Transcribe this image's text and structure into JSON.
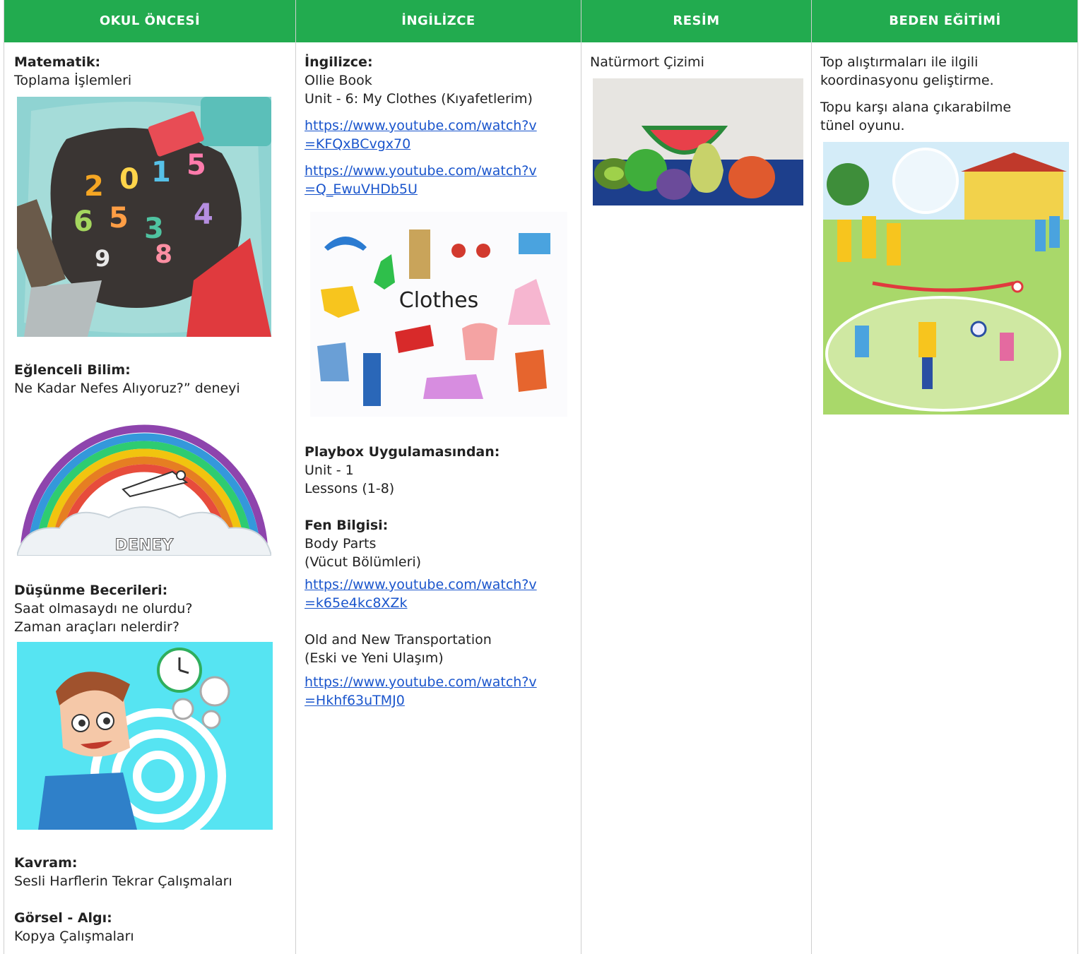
{
  "headers": [
    "OKUL ÖNCESİ",
    "İNGİLİZCE",
    "RESİM",
    "BEDEN EĞİTİMİ"
  ],
  "okul": {
    "matematik_title": "Matematik:",
    "matematik_text": "Toplama İşlemleri",
    "bilim_title": "Eğlenceli Bilim:",
    "bilim_text": "Ne Kadar Nefes Alıyoruz?” deneyi",
    "deney_label": "DENEY",
    "dusunme_title": "Düşünme Becerileri:",
    "dusunme_line1": "Saat olmasaydı ne olurdu?",
    "dusunme_line2": "Zaman araçları nelerdir?",
    "kavram_title": "Kavram:",
    "kavram_text": "Sesli Harflerin Tekrar Çalışmaları",
    "gorsel_title": "Görsel - Algı:",
    "gorsel_text": "Kopya Çalışmaları"
  },
  "ingilizce": {
    "title": "İngilizce:",
    "book": "Ollie Book",
    "unit": "Unit - 6: My Clothes (Kıyafetlerim)",
    "link1_a": "https://www.youtube.com/watch?v",
    "link1_b": "=KFQxBCvgx70",
    "link2_a": "https://www.youtube.com/watch?v",
    "link2_b": "=Q_EwuVHDb5U",
    "clothes_label": "Clothes",
    "playbox_title": "Playbox Uygulamasından:",
    "playbox_unit": "Unit - 1",
    "playbox_lessons": "Lessons (1-8)",
    "fen_title": "Fen Bilgisi:",
    "fen_line1": "Body Parts",
    "fen_line2": "(Vücut Bölümleri)",
    "link3_a": "https://www.youtube.com/watch?v",
    "link3_b": "=k65e4kc8XZk",
    "transport_line1": "Old and New Transportation",
    "transport_line2": "(Eski ve Yeni Ulaşım)",
    "link4_a": "https://www.youtube.com/watch?v",
    "link4_b": "=Hkhf63uTMJ0"
  },
  "resim": {
    "text": "Natürmort Çizimi"
  },
  "beden": {
    "line1": "Top alıştırmaları ile ilgili",
    "line2": "koordinasyonu geliştirme.",
    "line3": "Topu karşı alana çıkarabilme",
    "line4": "tünel oyunu."
  },
  "colors": {
    "header": "#22ab4f",
    "link": "#1a55cc",
    "border": "#cfcfcf"
  }
}
